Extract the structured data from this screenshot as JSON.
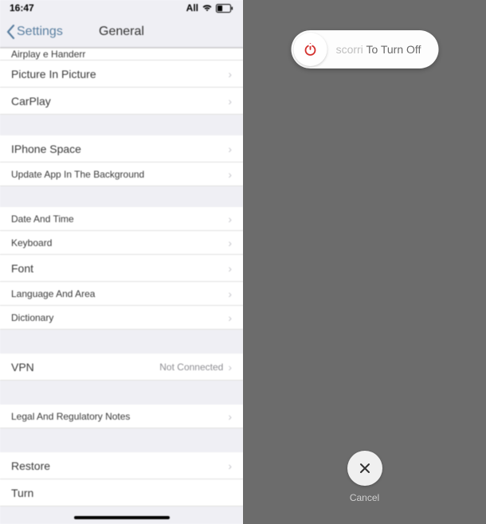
{
  "status": {
    "time": "16:47",
    "carrier": "All"
  },
  "nav": {
    "back": "Settings",
    "title": "General"
  },
  "rows": {
    "airplay": "Airplay e Handerr",
    "pip": "Picture In Picture",
    "carplay": "CarPlay",
    "space": "IPhone Space",
    "update": "Update App In The Background",
    "datetime": "Date And Time",
    "keyboard": "Keyboard",
    "font": "Font",
    "lang": "Language And Area",
    "dict": "Dictionary",
    "vpn": "VPN",
    "vpn_value": "Not Connected",
    "legal": "Legal And Regulatory Notes",
    "restore": "Restore",
    "turn": "Turn"
  },
  "power": {
    "slide_faded": "scorri",
    "slide_main": "To Turn Off",
    "cancel": "Cancel"
  }
}
